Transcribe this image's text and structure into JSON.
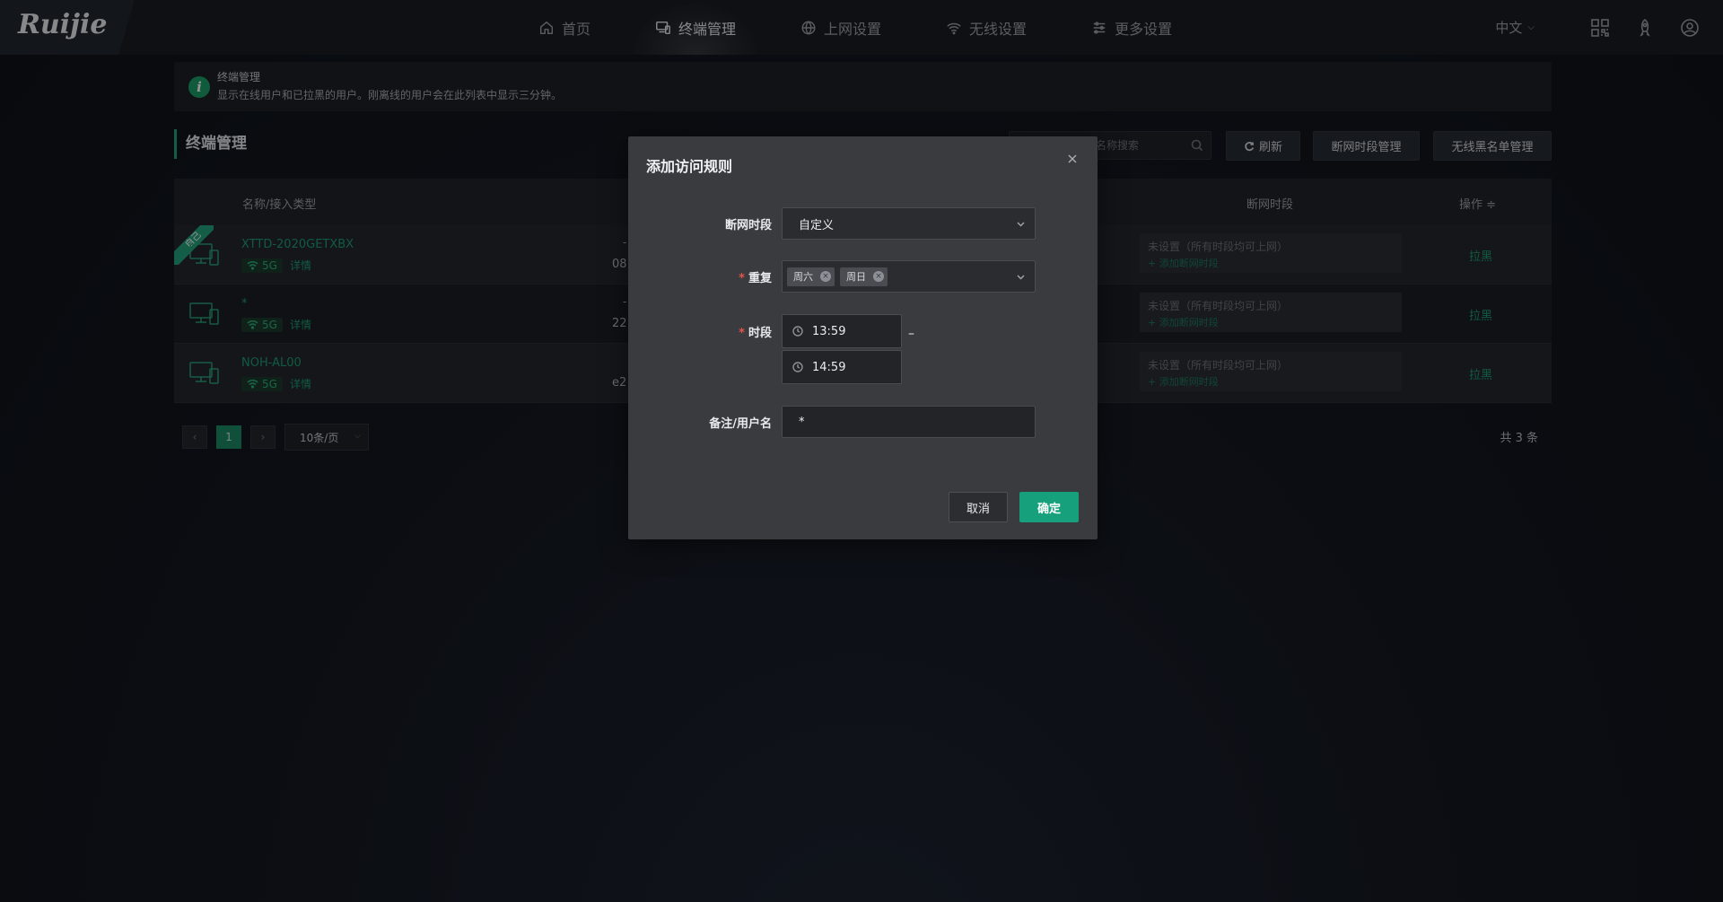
{
  "brand": {
    "logo": "Ruijie"
  },
  "nav": {
    "items": [
      {
        "label": "首页",
        "icon": "home-icon"
      },
      {
        "label": "终端管理",
        "icon": "devices-icon",
        "active": true
      },
      {
        "label": "上网设置",
        "icon": "globe-icon"
      },
      {
        "label": "无线设置",
        "icon": "wifi-icon"
      },
      {
        "label": "更多设置",
        "icon": "sliders-icon"
      }
    ],
    "language": "中文"
  },
  "banner": {
    "title": "终端管理",
    "description": "显示在线用户和已拉黑的用户。刚离线的用户会在此列表中显示三分钟。"
  },
  "section": {
    "title": "终端管理",
    "search_placeholder": "名称搜索",
    "refresh_label": "刷新",
    "schedule_manage_label": "断网时段管理",
    "wireless_blacklist_label": "无线黑名单管理"
  },
  "table": {
    "headers": {
      "name": "名称/接入类型",
      "schedule": "断网时段",
      "operation": "操作 ≑"
    },
    "rows": [
      {
        "self_tag": "自己",
        "name": "XTTD-2020GETXBX",
        "band": "5G",
        "detail": "详情",
        "mid_a": "-",
        "mid_b": "08:",
        "sched_a": "未设置（所有时段均可上网）",
        "sched_b": "+ 添加断网时段",
        "op": "拉黑"
      },
      {
        "self_tag": "",
        "name": "*",
        "band": "5G",
        "detail": "详情",
        "mid_a": "-",
        "mid_b": "22",
        "sched_a": "未设置（所有时段均可上网）",
        "sched_b": "+ 添加断网时段",
        "op": "拉黑"
      },
      {
        "self_tag": "",
        "name": "NOH-AL00",
        "band": "5G",
        "detail": "详情",
        "mid_a": "",
        "mid_b": "e2",
        "sched_a": "未设置（所有时段均可上网）",
        "sched_b": "+ 添加断网时段",
        "op": "拉黑"
      }
    ]
  },
  "pager": {
    "prev": "‹",
    "current": "1",
    "next": "›",
    "page_size": "10条/页",
    "total": "共 3 条"
  },
  "modal": {
    "title": "添加访问规则",
    "schedule_label": "断网时段",
    "schedule_value": "自定义",
    "repeat_label": "重复",
    "repeat_tags": [
      "周六",
      "周日"
    ],
    "time_label": "时段",
    "time_start": "13:59",
    "time_end": "14:59",
    "time_dash": "–",
    "remark_label": "备注/用户名",
    "remark_value": "*",
    "cancel_label": "取消",
    "ok_label": "确定"
  },
  "colors": {
    "accent": "#16a07c",
    "required": "#e5534b",
    "link_green": "#1f9e70"
  }
}
